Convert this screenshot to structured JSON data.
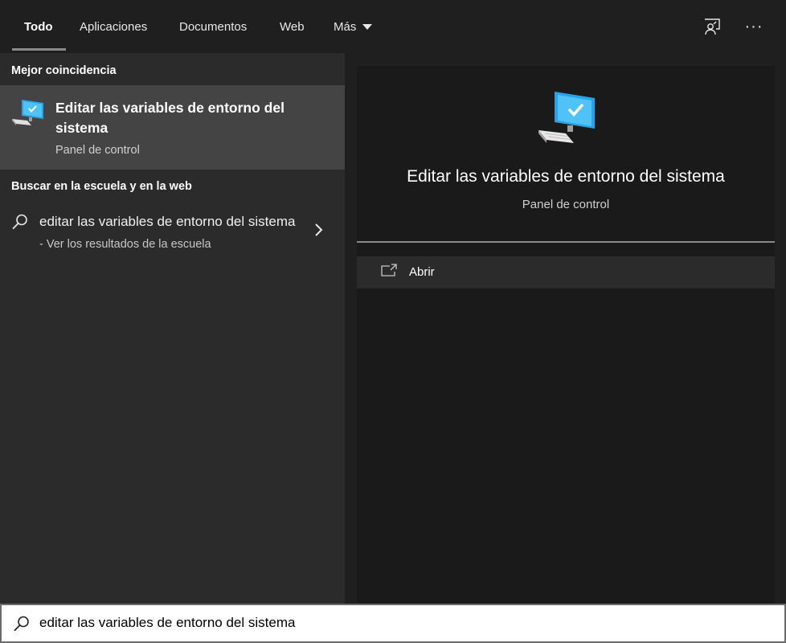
{
  "tabs": [
    {
      "label": "Todo",
      "active": true
    },
    {
      "label": "Aplicaciones"
    },
    {
      "label": "Documentos"
    },
    {
      "label": "Web"
    },
    {
      "label": "Más"
    }
  ],
  "top_icons": [
    "feedback-icon",
    "more-options-icon"
  ],
  "more_options_glyph": "···",
  "left": {
    "best_match_heading": "Mejor coincidencia",
    "best_match": {
      "title": "Editar las variables de entorno del sistema",
      "subtitle": "Panel de control",
      "icon": "system-computer-icon"
    },
    "web_heading": "Buscar en la escuela y en la web",
    "web_result": {
      "query": "editar las variables de entorno del sistema",
      "suffix": " - Ver los resultados de la escuela"
    }
  },
  "preview": {
    "title": "Editar las variables de entorno del sistema",
    "subtitle": "Panel de control",
    "action_label": "Abrir"
  },
  "search": {
    "value": "editar las variables de entorno del sistema"
  },
  "colors": {
    "accent_blue": "#29a3e8",
    "highlight": "#444444"
  }
}
